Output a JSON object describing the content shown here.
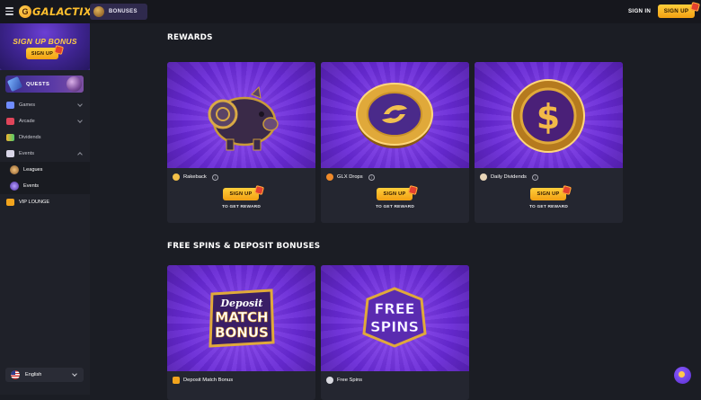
{
  "header": {
    "logo_text": "GALACTIX",
    "bonuses_tab": "BONUSES",
    "sign_in": "SIGN IN",
    "sign_up": "SIGN UP"
  },
  "sidebar": {
    "banner_title": "SIGN UP BONUS",
    "banner_button": "SIGN UP",
    "quests": "QUESTS",
    "items": [
      {
        "label": "Games",
        "icon": "gamepad-icon"
      },
      {
        "label": "Arcade",
        "icon": "arcade-icon"
      },
      {
        "label": "Dividends",
        "icon": "chart-icon"
      },
      {
        "label": "Events",
        "icon": "calendar-icon"
      }
    ],
    "sub_items": [
      {
        "label": "Leagues",
        "icon": "trophy-icon"
      },
      {
        "label": "Events",
        "icon": "event-icon"
      }
    ],
    "vip": "VIP LOUNGE",
    "language": "English"
  },
  "rewards": {
    "title": "REWARDS",
    "cards": [
      {
        "label": "Rakeback",
        "button": "SIGN UP",
        "caption": "TO GET REWARD"
      },
      {
        "label": "GLX Drops",
        "button": "SIGN UP",
        "caption": "TO GET REWARD"
      },
      {
        "label": "Daily Dividends",
        "button": "SIGN UP",
        "caption": "TO GET REWARD"
      }
    ]
  },
  "free_spins": {
    "title": "FREE SPINS & DEPOSIT BONUSES",
    "cards": [
      {
        "label": "Deposit Match Bonus",
        "art_lines": [
          "Deposit",
          "MATCH",
          "BONUS"
        ]
      },
      {
        "label": "Free Spins",
        "art_lines": [
          "FREE",
          "SPINS"
        ]
      }
    ]
  },
  "colors": {
    "accent": "#ffbf2e",
    "purple": "#6a2bd6",
    "background": "#1b1d24"
  }
}
